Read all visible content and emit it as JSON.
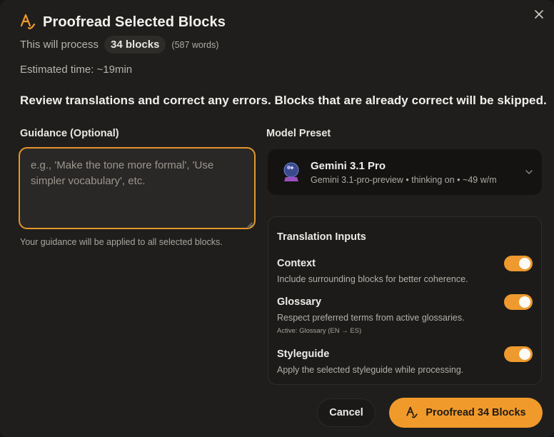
{
  "dialog": {
    "title": "Proofread Selected Blocks",
    "process_prefix": "This will process",
    "blocks_count": "34 blocks",
    "words_count": "(587 words)",
    "estimated_time": "Estimated time: ~19min",
    "description": "Review translations and correct any errors. Blocks that are already correct will be skipped."
  },
  "guidance": {
    "label": "Guidance (Optional)",
    "placeholder": "e.g., 'Make the tone more formal', 'Use simpler vocabulary', etc.",
    "value": "",
    "hint": "Your guidance will be applied to all selected blocks."
  },
  "model_preset": {
    "label": "Model Preset",
    "name": "Gemini 3.1 Pro",
    "subtitle": "Gemini 3.1-pro-preview • thinking on • ~49 w/m"
  },
  "translation_inputs": {
    "title": "Translation Inputs",
    "options": [
      {
        "name": "Context",
        "description": "Include surrounding blocks for better coherence.",
        "enabled": true
      },
      {
        "name": "Glossary",
        "description": "Respect preferred terms from active glossaries.",
        "sub": "Active: Glossary (EN → ES)",
        "enabled": true
      },
      {
        "name": "Styleguide",
        "description": "Apply the selected styleguide while processing.",
        "enabled": true
      }
    ]
  },
  "footer": {
    "cancel_label": "Cancel",
    "primary_label": "Proofread 34 Blocks"
  },
  "colors": {
    "accent": "#f19a2c",
    "background": "#1f1e1c",
    "text": "#ecebe8"
  },
  "icons": {
    "close": "close-icon",
    "logo": "proofread-logo-icon",
    "preset": "crystal-ball-icon",
    "chevron": "chevron-down-icon"
  }
}
